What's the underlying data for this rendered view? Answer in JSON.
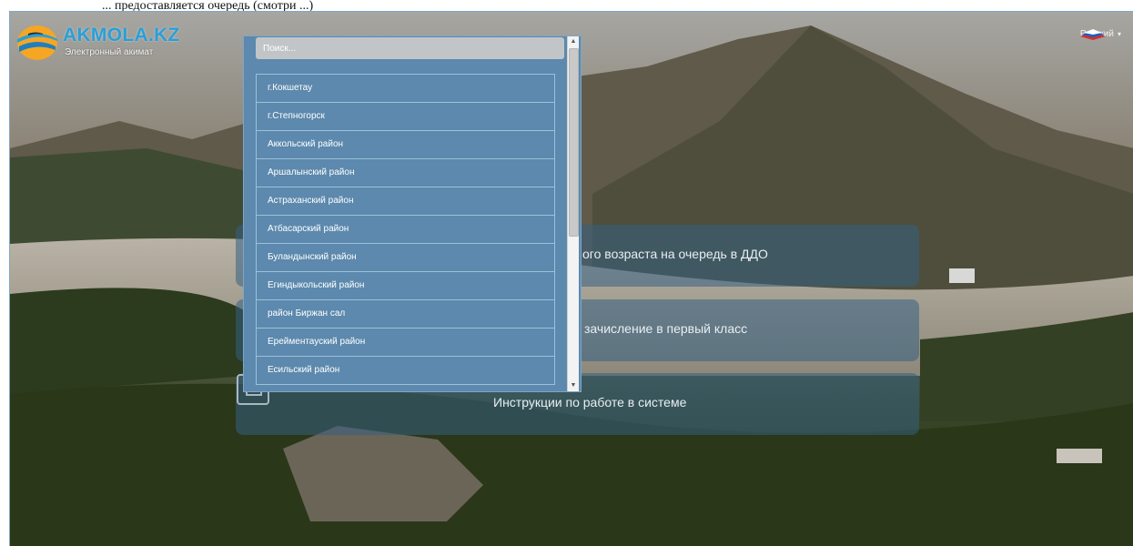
{
  "caption": "... предоставляется очередь (смотри ...)",
  "header": {
    "logo_title": "AKMOLA.KZ",
    "logo_subtitle": "Электронный акимат",
    "language": "Русский"
  },
  "cards": [
    {
      "label": "ьного возраста на очередь в ДДО"
    },
    {
      "label": "зачисление в первый класс"
    },
    {
      "label": "Инструкции по работе в системе"
    }
  ],
  "dropdown": {
    "search_placeholder": "Поиск...",
    "items": [
      {
        "label": "г.Кокшетау"
      },
      {
        "label": "г.Степногорск"
      },
      {
        "label": "Аккольский район"
      },
      {
        "label": "Аршалынский район"
      },
      {
        "label": "Астраханский район"
      },
      {
        "label": "Атбасарский район"
      },
      {
        "label": "Буландынский район"
      },
      {
        "label": "Егиндыкольский район"
      },
      {
        "label": "район Биржан сал"
      },
      {
        "label": "Ерейментауский район"
      },
      {
        "label": "Есильский район"
      }
    ]
  },
  "colors": {
    "logo_blue": "#2a9fd8",
    "dropdown_bg": "#5c89ad",
    "card_bg": "rgba(52,96,130,0.55)"
  }
}
